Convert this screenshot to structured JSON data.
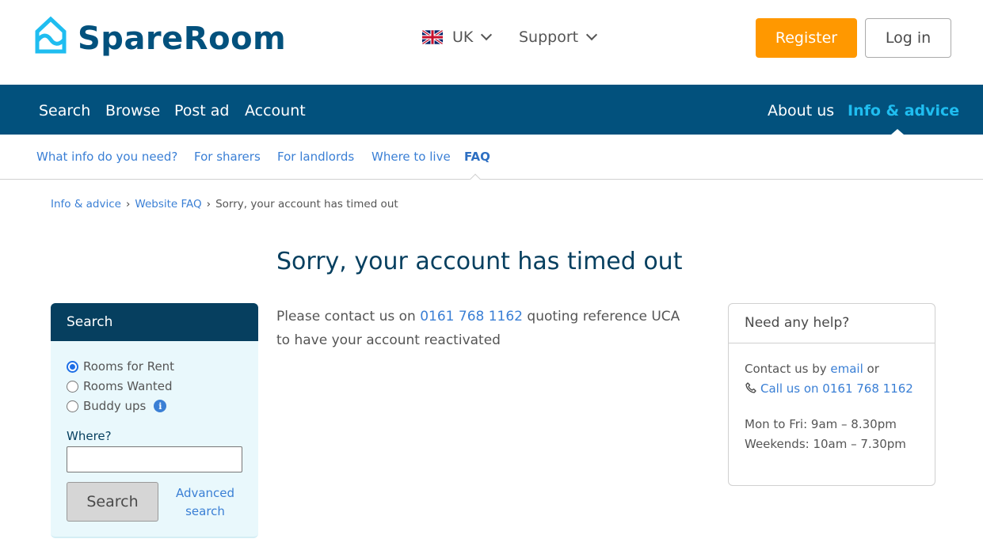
{
  "header": {
    "logo_text": "SpareRoom",
    "region_label": "UK",
    "support_label": "Support",
    "register_label": "Register",
    "login_label": "Log in"
  },
  "main_nav": {
    "left_items": [
      "Search",
      "Browse",
      "Post ad",
      "Account"
    ],
    "right_items": [
      "About us",
      "Info & advice"
    ],
    "active": "Info & advice"
  },
  "sub_nav": {
    "items": [
      "What info do you need?",
      "For sharers",
      "For landlords",
      "Where to live",
      "FAQ"
    ],
    "active": "FAQ"
  },
  "breadcrumb": {
    "items": [
      "Info & advice",
      "Website FAQ"
    ],
    "separator": "›",
    "current": "Sorry, your account has timed out"
  },
  "page": {
    "title": "Sorry, your account has timed out",
    "body_prefix": "Please contact us on ",
    "phone": "0161 768 1162",
    "body_suffix": " quoting reference UCA to have your account reactivated"
  },
  "search_panel": {
    "heading": "Search",
    "options": [
      {
        "label": "Rooms for Rent",
        "checked": true
      },
      {
        "label": "Rooms Wanted",
        "checked": false
      },
      {
        "label": "Buddy ups",
        "checked": false
      }
    ],
    "info_glyph": "i",
    "where_label": "Where?",
    "where_value": "",
    "where_placeholder": "",
    "search_button": "Search",
    "advanced_line1": "Advanced",
    "advanced_line2": "search"
  },
  "help_box": {
    "heading": "Need any help?",
    "contact_prefix": "Contact us by ",
    "email_link": "email",
    "contact_suffix": " or",
    "call_link": "Call us on 0161 768 1162",
    "weekday_hours": "Mon to Fri: 9am – 8.30pm",
    "weekend_hours": "Weekends: 10am – 7.30pm"
  },
  "colors": {
    "brand_dark": "#02517d",
    "brand_light": "#1fbdf0",
    "register": "#ff9800",
    "link": "#3a7fd5",
    "panel_bg": "#e9f8fc"
  }
}
